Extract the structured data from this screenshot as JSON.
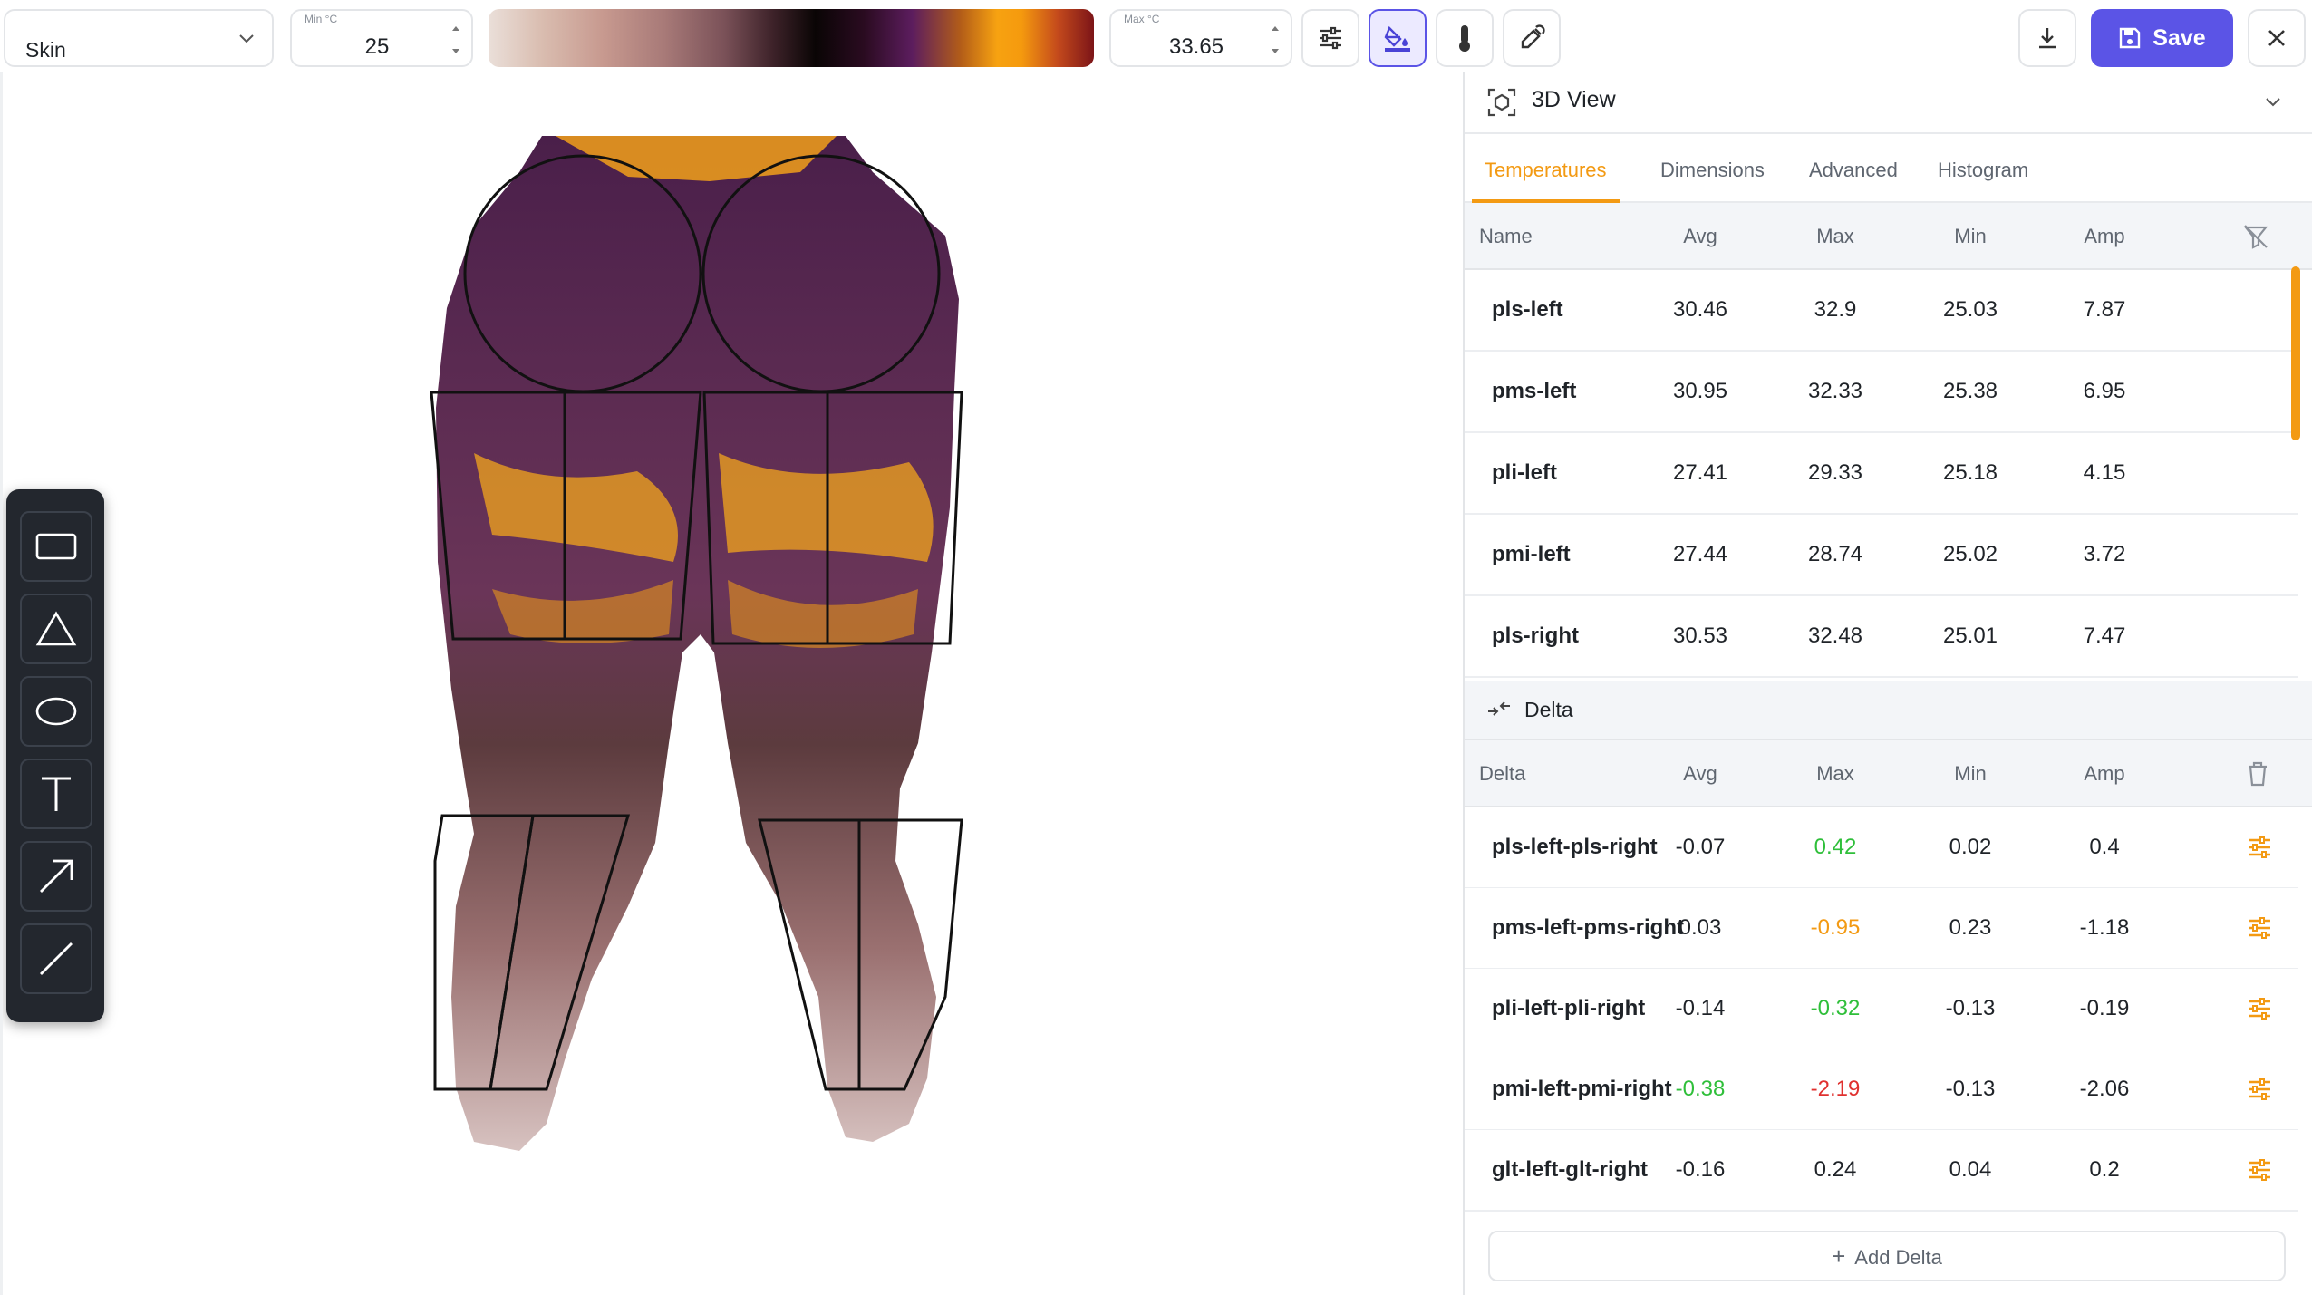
{
  "toolbar": {
    "preset_value": "Skin",
    "min_label": "Min °C",
    "min_value": "25",
    "max_label": "Max °C",
    "max_value": "33.65",
    "save_label": "Save",
    "icons": [
      "sliders-icon",
      "fill-bucket-icon",
      "thermometer-icon",
      "eyedropper-icon",
      "download-icon",
      "save-disk-icon",
      "close-icon"
    ],
    "palette_colors": [
      "#eadfd9",
      "#c7998f",
      "#0a0505",
      "#5c1d5e",
      "#f7a211",
      "#7c1418"
    ]
  },
  "tools": [
    "rectangle-tool",
    "triangle-tool",
    "ellipse-tool",
    "text-tool",
    "arrow-tool",
    "line-tool"
  ],
  "panel": {
    "title": "3D View",
    "tabs": [
      {
        "label": "Temperatures",
        "active": true
      },
      {
        "label": "Dimensions",
        "active": false
      },
      {
        "label": "Advanced",
        "active": false
      },
      {
        "label": "Histogram",
        "active": false
      }
    ],
    "temps": {
      "columns": [
        "Name",
        "Avg",
        "Max",
        "Min",
        "Amp"
      ],
      "rows": [
        {
          "name": "pls-left",
          "avg": "30.46",
          "max": "32.9",
          "min": "25.03",
          "amp": "7.87"
        },
        {
          "name": "pms-left",
          "avg": "30.95",
          "max": "32.33",
          "min": "25.38",
          "amp": "6.95"
        },
        {
          "name": "pli-left",
          "avg": "27.41",
          "max": "29.33",
          "min": "25.18",
          "amp": "4.15"
        },
        {
          "name": "pmi-left",
          "avg": "27.44",
          "max": "28.74",
          "min": "25.02",
          "amp": "3.72"
        },
        {
          "name": "pls-right",
          "avg": "30.53",
          "max": "32.48",
          "min": "25.01",
          "amp": "7.47"
        }
      ]
    },
    "delta_section_title": "Delta",
    "delta": {
      "columns": [
        "Delta",
        "Avg",
        "Max",
        "Min",
        "Amp"
      ],
      "rows": [
        {
          "name": "pls-left-pls-right",
          "avg": "-0.07",
          "max": "0.42",
          "min": "0.02",
          "amp": "0.4",
          "max_color": "#2fbf3a"
        },
        {
          "name": "pms-left-pms-right",
          "avg": "0.03",
          "max": "-0.95",
          "min": "0.23",
          "amp": "-1.18",
          "max_color": "#f39a13"
        },
        {
          "name": "pli-left-pli-right",
          "avg": "-0.14",
          "max": "-0.32",
          "min": "-0.13",
          "amp": "-0.19",
          "max_color": "#2fbf3a"
        },
        {
          "name": "pmi-left-pmi-right",
          "avg": "-0.38",
          "max": "-2.19",
          "min": "-0.13",
          "amp": "-2.06",
          "avg_color": "#2fbf3a",
          "max_color": "#e0312f"
        },
        {
          "name": "glt-left-glt-right",
          "avg": "-0.16",
          "max": "0.24",
          "min": "0.04",
          "amp": "0.2"
        }
      ]
    },
    "add_delta_label": "Add Delta",
    "accent_color": "#f39a13",
    "brand_color": "#5b54e6"
  }
}
